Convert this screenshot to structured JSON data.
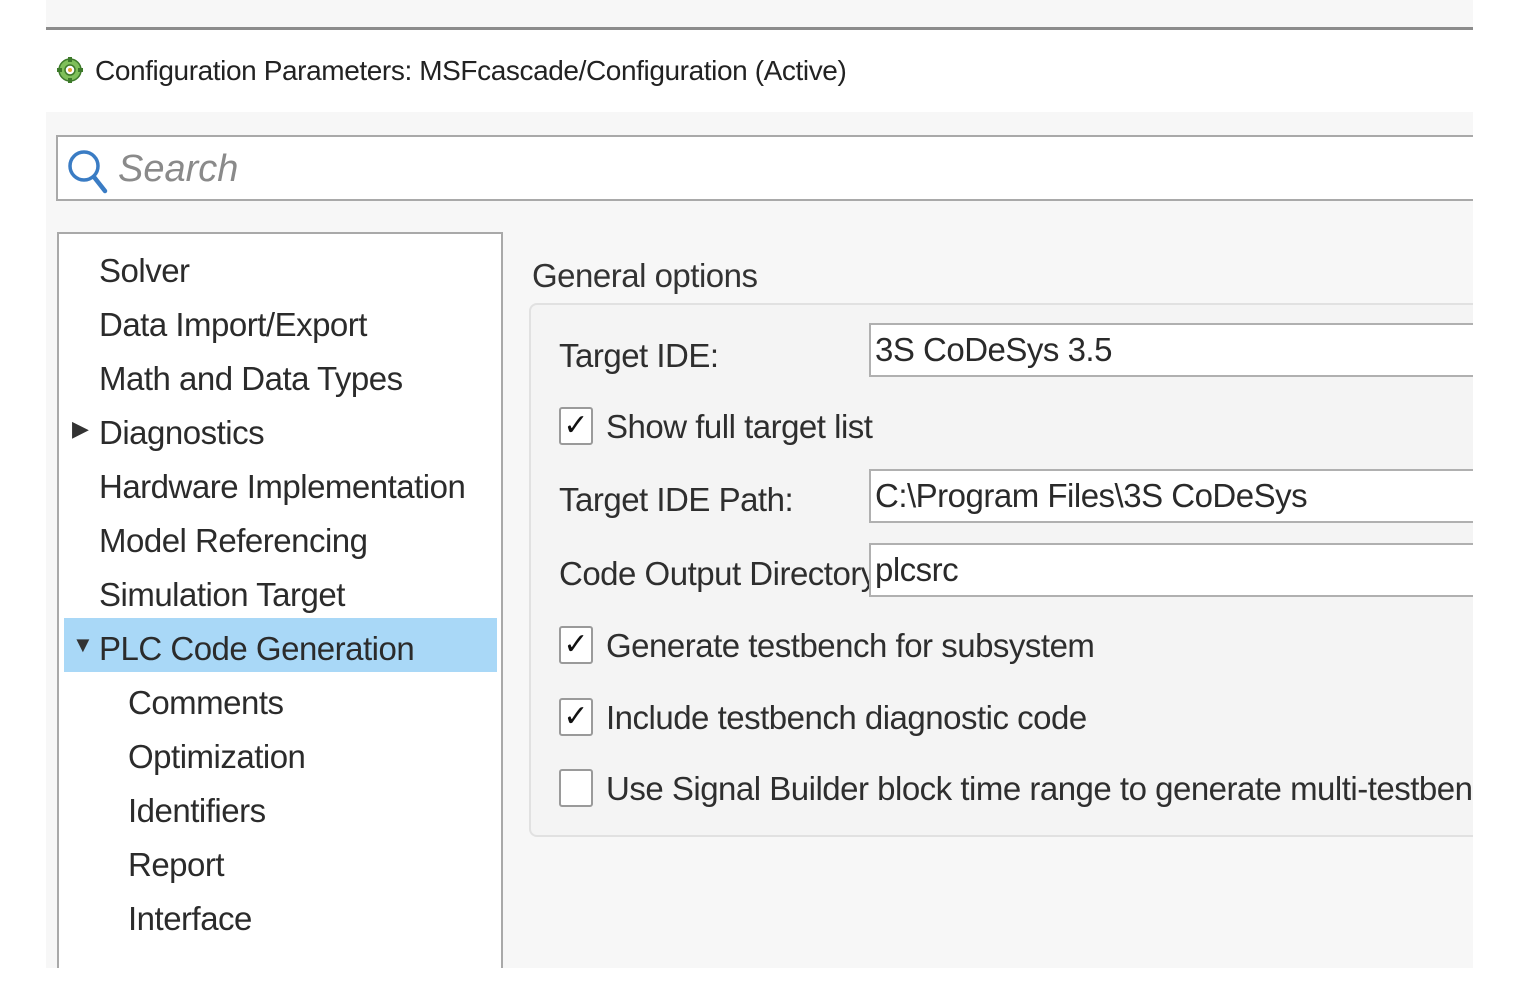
{
  "window": {
    "title": "Configuration Parameters: MSFcascade/Configuration (Active)",
    "icon": "gear-settings-icon"
  },
  "search": {
    "placeholder": "Search",
    "value": ""
  },
  "nav": {
    "items": [
      {
        "label": "Solver",
        "level": 0,
        "expander": "",
        "selected": false
      },
      {
        "label": "Data Import/Export",
        "level": 0,
        "expander": "",
        "selected": false
      },
      {
        "label": "Math and Data Types",
        "level": 0,
        "expander": "",
        "selected": false
      },
      {
        "label": "Diagnostics",
        "level": 0,
        "expander": "collapsed",
        "selected": false
      },
      {
        "label": "Hardware Implementation",
        "level": 0,
        "expander": "",
        "selected": false
      },
      {
        "label": "Model Referencing",
        "level": 0,
        "expander": "",
        "selected": false
      },
      {
        "label": "Simulation Target",
        "level": 0,
        "expander": "",
        "selected": false
      },
      {
        "label": "PLC Code Generation",
        "level": 0,
        "expander": "expanded",
        "selected": true
      },
      {
        "label": "Comments",
        "level": 1,
        "expander": "",
        "selected": false
      },
      {
        "label": "Optimization",
        "level": 1,
        "expander": "",
        "selected": false
      },
      {
        "label": "Identifiers",
        "level": 1,
        "expander": "",
        "selected": false
      },
      {
        "label": "Report",
        "level": 1,
        "expander": "",
        "selected": false
      },
      {
        "label": "Interface",
        "level": 1,
        "expander": "",
        "selected": false
      }
    ],
    "selected_color": "#a9d8f7"
  },
  "general": {
    "section_title": "General options",
    "target_ide_label": "Target IDE:",
    "target_ide_value": "3S CoDeSys 3.5",
    "show_full_target_list_label": "Show full target list",
    "show_full_target_list_checked": true,
    "target_ide_path_label": "Target IDE Path:",
    "target_ide_path_value": "C:\\Program Files\\3S CoDeSys",
    "code_output_dir_label": "Code Output Directory:",
    "code_output_dir_value": "plcsrc",
    "generate_testbench_label": "Generate testbench for subsystem",
    "generate_testbench_checked": true,
    "include_diag_label": "Include testbench diagnostic code",
    "include_diag_checked": true,
    "use_signal_builder_label": "Use Signal Builder block time range to generate multi-testbench",
    "use_signal_builder_checked": false
  }
}
